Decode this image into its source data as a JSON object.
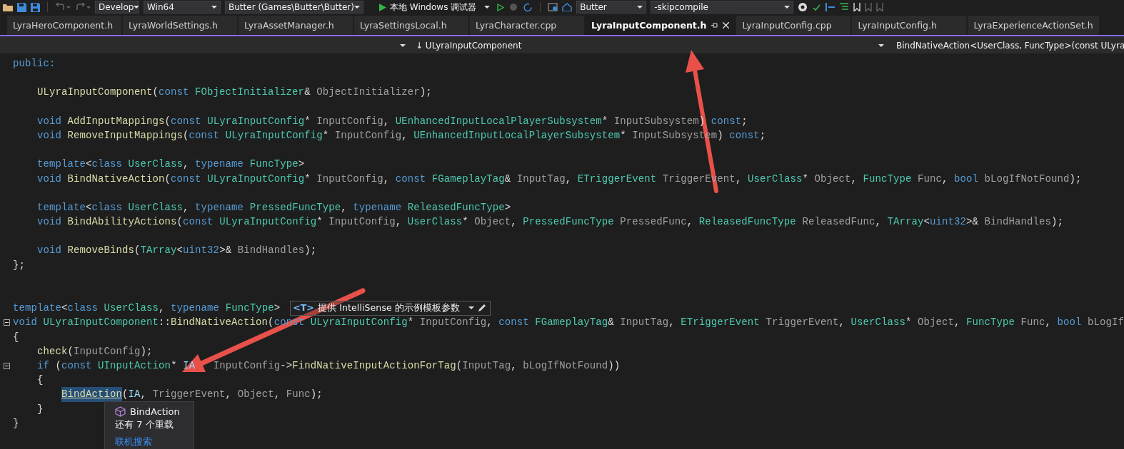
{
  "toolbar": {
    "configuration": "Develop",
    "platform": "Win64",
    "startup_project": "Butter (Games\\Butter\\Butter)",
    "debugger": "本地 Windows 调试器",
    "project": "Butter",
    "arguments": "-skipcompile"
  },
  "tabs": [
    {
      "label": "LyraHeroComponent.h",
      "selected": false
    },
    {
      "label": "LyraWorldSettings.h",
      "selected": false
    },
    {
      "label": "LyraAssetManager.h",
      "selected": false
    },
    {
      "label": "LyraSettingsLocal.h",
      "selected": false
    },
    {
      "label": "LyraCharacter.cpp",
      "selected": false
    },
    {
      "label": "LyraInputComponent.h",
      "selected": true
    },
    {
      "label": "LyraInputConfig.cpp",
      "selected": false
    },
    {
      "label": "LyraInputConfig.h",
      "selected": false
    },
    {
      "label": "LyraExperienceActionSet.h",
      "selected": false
    }
  ],
  "navigation_bar": {
    "scope": "↓ ULyraInputComponent",
    "member": "BindNativeAction<UserClass, FuncType>(const ULyra"
  },
  "editor": {
    "lines": [
      {
        "kind": "code",
        "tokens": [
          {
            "text": "public:",
            "kind": "keyword"
          }
        ]
      },
      {
        "kind": "blank"
      },
      {
        "kind": "code",
        "tokens": [
          {
            "text": "    ULyraInputComponent",
            "kind": "function"
          },
          {
            "text": "(",
            "kind": "plain"
          },
          {
            "text": "const",
            "kind": "keyword"
          },
          {
            "text": " FObjectInitializer",
            "kind": "type"
          },
          {
            "text": "& ",
            "kind": "plain"
          },
          {
            "text": "ObjectInitializer",
            "kind": "param"
          },
          {
            "text": ");",
            "kind": "plain"
          }
        ]
      },
      {
        "kind": "blank"
      },
      {
        "kind": "code",
        "tokens": [
          {
            "text": "    void",
            "kind": "keyword"
          },
          {
            "text": " AddInputMappings",
            "kind": "function"
          },
          {
            "text": "(",
            "kind": "plain"
          },
          {
            "text": "const",
            "kind": "keyword"
          },
          {
            "text": " ULyraInputConfig",
            "kind": "type"
          },
          {
            "text": "* ",
            "kind": "plain"
          },
          {
            "text": "InputConfig",
            "kind": "param"
          },
          {
            "text": ", ",
            "kind": "plain"
          },
          {
            "text": "UEnhancedInputLocalPlayerSubsystem",
            "kind": "type"
          },
          {
            "text": "* ",
            "kind": "plain"
          },
          {
            "text": "InputSubsystem",
            "kind": "param"
          },
          {
            "text": ") ",
            "kind": "plain"
          },
          {
            "text": "const",
            "kind": "keyword"
          },
          {
            "text": ";",
            "kind": "plain"
          }
        ]
      },
      {
        "kind": "code",
        "tokens": [
          {
            "text": "    void",
            "kind": "keyword"
          },
          {
            "text": " RemoveInputMappings",
            "kind": "function"
          },
          {
            "text": "(",
            "kind": "plain"
          },
          {
            "text": "const",
            "kind": "keyword"
          },
          {
            "text": " ULyraInputConfig",
            "kind": "type"
          },
          {
            "text": "* ",
            "kind": "plain"
          },
          {
            "text": "InputConfig",
            "kind": "param"
          },
          {
            "text": ", ",
            "kind": "plain"
          },
          {
            "text": "UEnhancedInputLocalPlayerSubsystem",
            "kind": "type"
          },
          {
            "text": "* ",
            "kind": "plain"
          },
          {
            "text": "InputSubsystem",
            "kind": "param"
          },
          {
            "text": ") ",
            "kind": "plain"
          },
          {
            "text": "const",
            "kind": "keyword"
          },
          {
            "text": ";",
            "kind": "plain"
          }
        ]
      },
      {
        "kind": "blank"
      },
      {
        "kind": "code",
        "tokens": [
          {
            "text": "    template",
            "kind": "keyword"
          },
          {
            "text": "<",
            "kind": "plain"
          },
          {
            "text": "class",
            "kind": "keyword"
          },
          {
            "text": " UserClass",
            "kind": "type"
          },
          {
            "text": ", ",
            "kind": "plain"
          },
          {
            "text": "typename",
            "kind": "keyword"
          },
          {
            "text": " FuncType",
            "kind": "type"
          },
          {
            "text": ">",
            "kind": "plain"
          }
        ]
      },
      {
        "kind": "code",
        "tokens": [
          {
            "text": "    void",
            "kind": "keyword"
          },
          {
            "text": " BindNativeAction",
            "kind": "function"
          },
          {
            "text": "(",
            "kind": "plain"
          },
          {
            "text": "const",
            "kind": "keyword"
          },
          {
            "text": " ULyraInputConfig",
            "kind": "type"
          },
          {
            "text": "* ",
            "kind": "plain"
          },
          {
            "text": "InputConfig",
            "kind": "param"
          },
          {
            "text": ", ",
            "kind": "plain"
          },
          {
            "text": "const",
            "kind": "keyword"
          },
          {
            "text": " FGameplayTag",
            "kind": "type"
          },
          {
            "text": "& ",
            "kind": "plain"
          },
          {
            "text": "InputTag",
            "kind": "param"
          },
          {
            "text": ", ",
            "kind": "plain"
          },
          {
            "text": "ETriggerEvent",
            "kind": "type"
          },
          {
            "text": " TriggerEvent",
            "kind": "param"
          },
          {
            "text": ", ",
            "kind": "plain"
          },
          {
            "text": "UserClass",
            "kind": "type"
          },
          {
            "text": "* ",
            "kind": "plain"
          },
          {
            "text": "Object",
            "kind": "param"
          },
          {
            "text": ", ",
            "kind": "plain"
          },
          {
            "text": "FuncType",
            "kind": "type"
          },
          {
            "text": " Func",
            "kind": "param"
          },
          {
            "text": ", ",
            "kind": "plain"
          },
          {
            "text": "bool",
            "kind": "keyword"
          },
          {
            "text": " bLogIfNotFound",
            "kind": "param"
          },
          {
            "text": ");",
            "kind": "plain"
          }
        ]
      },
      {
        "kind": "blank"
      },
      {
        "kind": "code",
        "tokens": [
          {
            "text": "    template",
            "kind": "keyword"
          },
          {
            "text": "<",
            "kind": "plain"
          },
          {
            "text": "class",
            "kind": "keyword"
          },
          {
            "text": " UserClass",
            "kind": "type"
          },
          {
            "text": ", ",
            "kind": "plain"
          },
          {
            "text": "typename",
            "kind": "keyword"
          },
          {
            "text": " PressedFuncType",
            "kind": "type"
          },
          {
            "text": ", ",
            "kind": "plain"
          },
          {
            "text": "typename",
            "kind": "keyword"
          },
          {
            "text": " ReleasedFuncType",
            "kind": "type"
          },
          {
            "text": ">",
            "kind": "plain"
          }
        ]
      },
      {
        "kind": "code",
        "tokens": [
          {
            "text": "    void",
            "kind": "keyword"
          },
          {
            "text": " BindAbilityActions",
            "kind": "function"
          },
          {
            "text": "(",
            "kind": "plain"
          },
          {
            "text": "const",
            "kind": "keyword"
          },
          {
            "text": " ULyraInputConfig",
            "kind": "type"
          },
          {
            "text": "* ",
            "kind": "plain"
          },
          {
            "text": "InputConfig",
            "kind": "param"
          },
          {
            "text": ", ",
            "kind": "plain"
          },
          {
            "text": "UserClass",
            "kind": "type"
          },
          {
            "text": "* ",
            "kind": "plain"
          },
          {
            "text": "Object",
            "kind": "param"
          },
          {
            "text": ", ",
            "kind": "plain"
          },
          {
            "text": "PressedFuncType",
            "kind": "type"
          },
          {
            "text": " PressedFunc",
            "kind": "param"
          },
          {
            "text": ", ",
            "kind": "plain"
          },
          {
            "text": "ReleasedFuncType",
            "kind": "type"
          },
          {
            "text": " ReleasedFunc",
            "kind": "param"
          },
          {
            "text": ", ",
            "kind": "plain"
          },
          {
            "text": "TArray",
            "kind": "type"
          },
          {
            "text": "<",
            "kind": "plain"
          },
          {
            "text": "uint32",
            "kind": "keyword"
          },
          {
            "text": ">& ",
            "kind": "plain"
          },
          {
            "text": "BindHandles",
            "kind": "param"
          },
          {
            "text": ");",
            "kind": "plain"
          }
        ]
      },
      {
        "kind": "blank"
      },
      {
        "kind": "code",
        "tokens": [
          {
            "text": "    void",
            "kind": "keyword"
          },
          {
            "text": " RemoveBinds",
            "kind": "function"
          },
          {
            "text": "(",
            "kind": "plain"
          },
          {
            "text": "TArray",
            "kind": "type"
          },
          {
            "text": "<",
            "kind": "plain"
          },
          {
            "text": "uint32",
            "kind": "keyword"
          },
          {
            "text": ">& ",
            "kind": "plain"
          },
          {
            "text": "BindHandles",
            "kind": "param"
          },
          {
            "text": ");",
            "kind": "plain"
          }
        ]
      },
      {
        "kind": "code",
        "tokens": [
          {
            "text": "};",
            "kind": "plain"
          }
        ]
      },
      {
        "kind": "blank"
      },
      {
        "kind": "blank"
      },
      {
        "kind": "code",
        "tokens": [
          {
            "text": "template",
            "kind": "keyword"
          },
          {
            "text": "<",
            "kind": "plain"
          },
          {
            "text": "class",
            "kind": "keyword"
          },
          {
            "text": " UserClass",
            "kind": "type"
          },
          {
            "text": ", ",
            "kind": "plain"
          },
          {
            "text": "typename",
            "kind": "keyword"
          },
          {
            "text": " FuncType",
            "kind": "type"
          },
          {
            "text": ">",
            "kind": "plain"
          }
        ],
        "hint": {
          "badge": "<T>",
          "text": "提供 IntelliSense 的示例模板参数"
        }
      },
      {
        "kind": "code",
        "fold_expanded": true,
        "tokens": [
          {
            "text": "void",
            "kind": "keyword"
          },
          {
            "text": " ULyraInputComponent",
            "kind": "type"
          },
          {
            "text": "::",
            "kind": "plain"
          },
          {
            "text": "BindNativeAction",
            "kind": "function"
          },
          {
            "text": "(",
            "kind": "plain"
          },
          {
            "text": "const",
            "kind": "keyword"
          },
          {
            "text": " ULyraInputConfig",
            "kind": "type"
          },
          {
            "text": "* ",
            "kind": "plain"
          },
          {
            "text": "InputConfig",
            "kind": "param"
          },
          {
            "text": ", ",
            "kind": "plain"
          },
          {
            "text": "const",
            "kind": "keyword"
          },
          {
            "text": " FGameplayTag",
            "kind": "type"
          },
          {
            "text": "& ",
            "kind": "plain"
          },
          {
            "text": "InputTag",
            "kind": "param"
          },
          {
            "text": ", ",
            "kind": "plain"
          },
          {
            "text": "ETriggerEvent",
            "kind": "type"
          },
          {
            "text": " TriggerEvent",
            "kind": "param"
          },
          {
            "text": ", ",
            "kind": "plain"
          },
          {
            "text": "UserClass",
            "kind": "type"
          },
          {
            "text": "* ",
            "kind": "plain"
          },
          {
            "text": "Object",
            "kind": "param"
          },
          {
            "text": ", ",
            "kind": "plain"
          },
          {
            "text": "FuncType",
            "kind": "type"
          },
          {
            "text": " Func",
            "kind": "param"
          },
          {
            "text": ", ",
            "kind": "plain"
          },
          {
            "text": "bool",
            "kind": "keyword"
          },
          {
            "text": " bLogIf",
            "kind": "param"
          }
        ]
      },
      {
        "kind": "code",
        "tokens": [
          {
            "text": "{",
            "kind": "plain"
          }
        ]
      },
      {
        "kind": "code",
        "tokens": [
          {
            "text": "    check",
            "kind": "function"
          },
          {
            "text": "(",
            "kind": "plain"
          },
          {
            "text": "InputConfig",
            "kind": "param"
          },
          {
            "text": ");",
            "kind": "plain"
          }
        ]
      },
      {
        "kind": "code",
        "fold_expanded": true,
        "tokens": [
          {
            "text": "    if",
            "kind": "keyword"
          },
          {
            "text": " (",
            "kind": "plain"
          },
          {
            "text": "const",
            "kind": "keyword"
          },
          {
            "text": " UInputAction",
            "kind": "type"
          },
          {
            "text": "* ",
            "kind": "plain"
          },
          {
            "text": "IA",
            "kind": "local"
          },
          {
            "text": "   InputConfig",
            "kind": "param"
          },
          {
            "text": "->",
            "kind": "plain"
          },
          {
            "text": "FindNativeInputActionForTag",
            "kind": "function"
          },
          {
            "text": "(",
            "kind": "plain"
          },
          {
            "text": "InputTag",
            "kind": "param"
          },
          {
            "text": ", ",
            "kind": "plain"
          },
          {
            "text": "bLogIfNotFound",
            "kind": "param"
          },
          {
            "text": "))",
            "kind": "plain"
          }
        ]
      },
      {
        "kind": "code",
        "tokens": [
          {
            "text": "    {",
            "kind": "plain"
          }
        ]
      },
      {
        "kind": "code",
        "tokens": [
          {
            "text": "        BindAction",
            "kind": "reference"
          },
          {
            "text": "(",
            "kind": "plain"
          },
          {
            "text": "IA",
            "kind": "local"
          },
          {
            "text": ", ",
            "kind": "plain"
          },
          {
            "text": "TriggerEvent",
            "kind": "param"
          },
          {
            "text": ", ",
            "kind": "plain"
          },
          {
            "text": "Object",
            "kind": "param"
          },
          {
            "text": ", ",
            "kind": "plain"
          },
          {
            "text": "Func",
            "kind": "param"
          },
          {
            "text": ");",
            "kind": "plain"
          }
        ]
      },
      {
        "kind": "code",
        "tokens": [
          {
            "text": "    }",
            "kind": "plain"
          }
        ]
      },
      {
        "kind": "code",
        "tokens": [
          {
            "text": "}",
            "kind": "plain"
          }
        ]
      }
    ]
  },
  "quick_info": {
    "title": "BindAction",
    "subtitle": "还有 7 个重载",
    "link": "联机搜索"
  }
}
